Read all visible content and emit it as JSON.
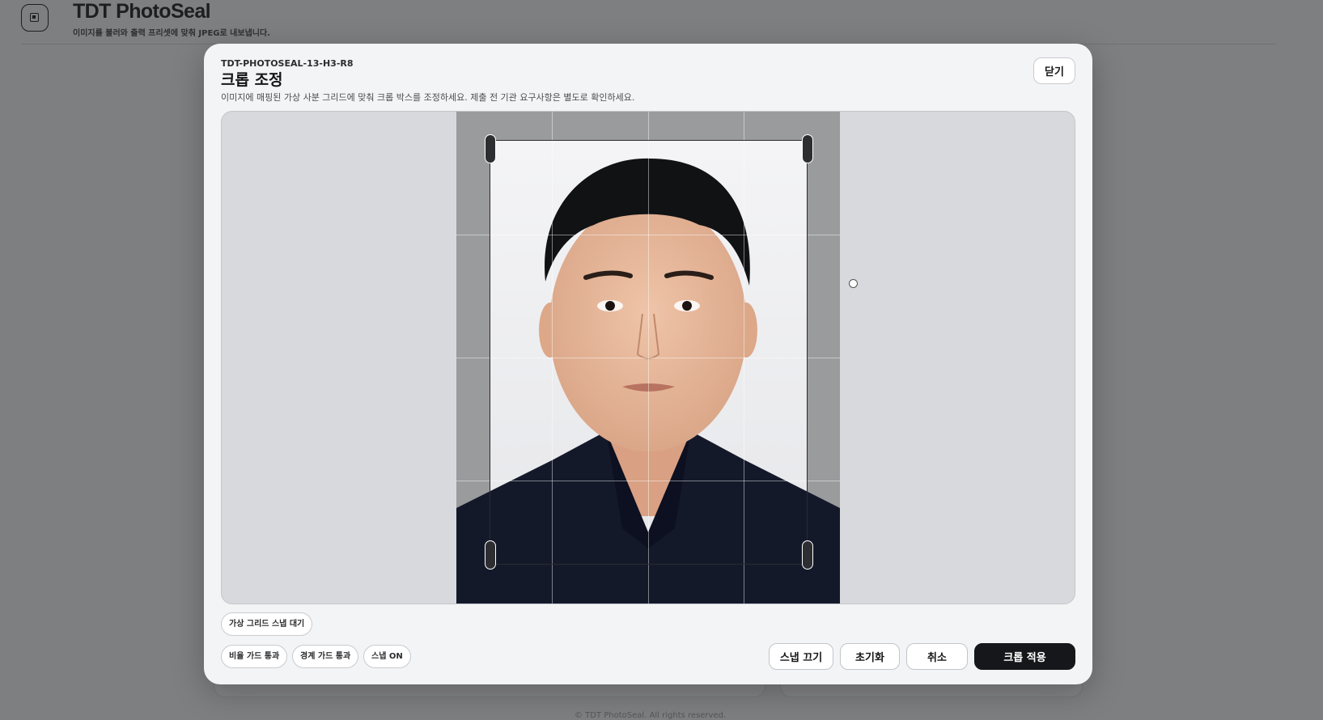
{
  "app": {
    "title": "TDT PhotoSeal",
    "subtitle": "이미지를 불러와 출력 프리셋에 맞춰 JPEG로 내보냅니다.",
    "footer": "© TDT PhotoSeal. All rights reserved."
  },
  "modal": {
    "code": "TDT-PHOTOSEAL-13-H3-R8",
    "title": "크롭 조정",
    "description": "이미지에 매핑된 가상 사분 그리드에 맞춰 크롭 박스를 조정하세요. 제출 전 기관 요구사항은 별도로 확인하세요.",
    "close_label": "닫기"
  },
  "status": {
    "snap_state": "가상 그리드 스냅 대기",
    "ratio_guard": "비율 가드 통과",
    "boundary_guard": "경계 가드 통과",
    "snap_on": "스냅 ON"
  },
  "actions": {
    "snap_off": "스냅 끄기",
    "reset": "초기화",
    "cancel": "취소",
    "apply": "크롭 적용"
  },
  "colors": {
    "primary": "#16171a",
    "surface": "#f3f4f6",
    "overlay": "#7e7f81"
  }
}
